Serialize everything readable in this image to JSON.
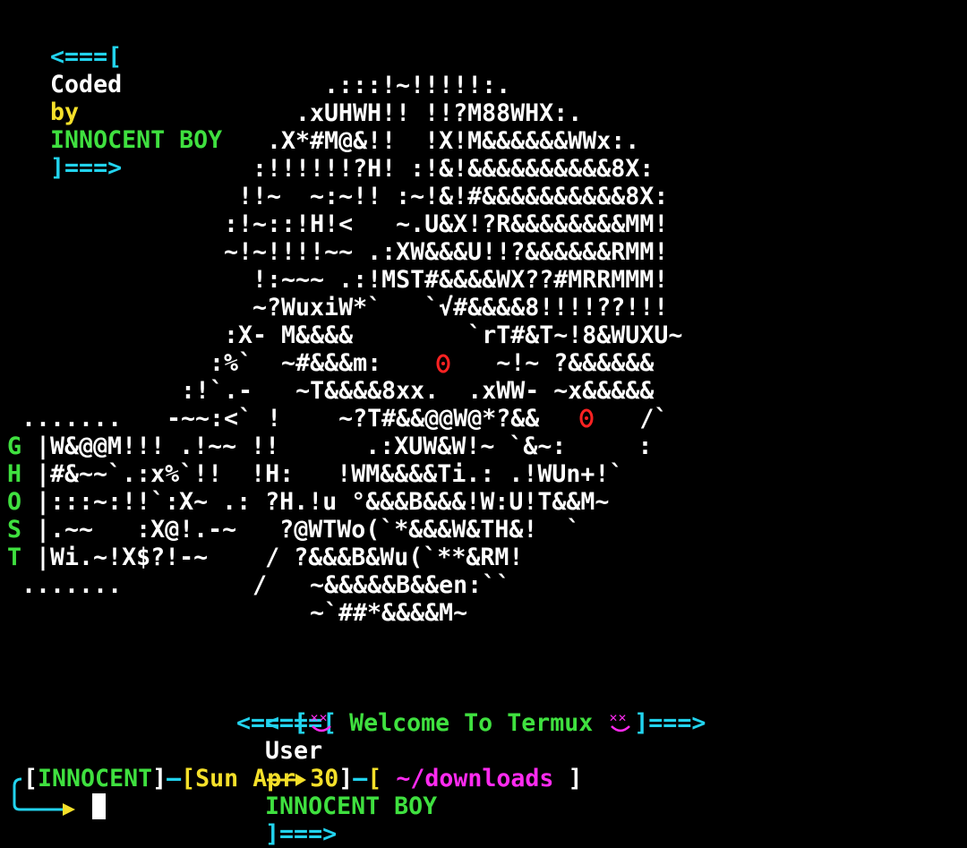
{
  "header": {
    "left": "<===[",
    "coded": "Coded",
    "by": "by",
    "author": "INNOCENT BOY",
    "right": "]===>"
  },
  "art": {
    "lines": [
      ".:::!~!!!!!:.",
      ".xUHWH!! !!?M88WHX:.",
      ".X*#M@&!!  !X!M&&&&&&WWx:.",
      ":!!!!!!?H! :!&!&&&&&&&&&&8X:",
      "!!~  ~:~!! :~!&!#&&&&&&&&&&8X:",
      ":!~::!H!<   ~.U&X!?R&&&&&&&&MM!",
      "~!~!!!!~~ .:XW&&&U!!?&&&&&&RMM!",
      "!:~~~ .:!MST#&&&&WX??#MRRMMM!",
      "~?WuxiW*`   `√#&&&&8!!!!??!!!",
      ":X- M&&&&        `rT#&T~!8&WUXU~",
      ":%`  ~#&&&m:        ~!~ ?&&&&&&",
      ":!`.-   ~T&&&&8xx.  .xWW- ~x&&&&&",
      "-~~:<` !    ~?T#&&@@W@*?&&       /`",
      "|W&@@M!!! .!~~ !!      .:XUW&W!~ `&~:     :",
      "|#&~~`.:x%`!!  !H:   !WM&&&&Ti.: .!WUn+!`",
      "|:::~:!!`:X~ .: ?H.!u °&&&B&&&!W:U!T&&M~",
      "|.~~   :X@!.-~   ?@WTWo(`*&&&W&TH&!  `",
      "|Wi.~!X$?!-~    / ?&&&B&Wu(`**&RM!",
      "/   ~&&&&&B&&en:``",
      "~`##*&&&&M~"
    ],
    "dots_top": ".......",
    "dots_bottom": ".......",
    "ghost": [
      "G",
      "H",
      "O",
      "S",
      "T"
    ]
  },
  "banner": {
    "user_left": "<===[",
    "user_label": "User",
    "user_name": "INNOCENT BOY",
    "user_right": "]===>",
    "welcome_left": "<===[",
    "welcome_text": "Welcome To Termux",
    "welcome_right": "]===>"
  },
  "prompt": {
    "user": "INNOCENT",
    "date": "Sun Apr 30",
    "path": "~/downloads"
  },
  "colors": {
    "background": "#000000",
    "cyan": "#22d3ee",
    "green": "#3fe03f",
    "yellow": "#f5e02a",
    "magenta": "#ff2bf0",
    "red_eye": "#ff2222"
  }
}
